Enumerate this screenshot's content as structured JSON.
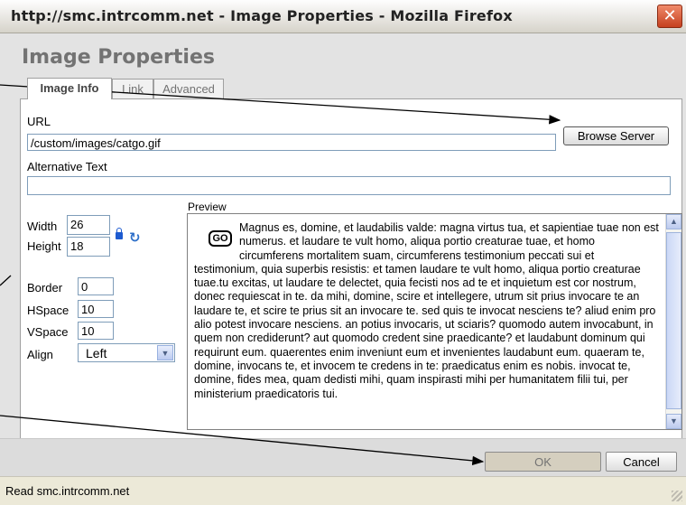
{
  "window": {
    "title": "http://smc.intrcomm.net - Image Properties - Mozilla Firefox",
    "close_glyph": "✕"
  },
  "dialog": {
    "heading": "Image Properties",
    "tabs": [
      {
        "label": "Image Info",
        "active": true
      },
      {
        "label": "Link",
        "active": false
      },
      {
        "label": "Advanced",
        "active": false
      }
    ],
    "url_label": "URL",
    "url_value": "/custom/images/catgo.gif",
    "browse_label": "Browse Server",
    "alt_label": "Alternative Text",
    "alt_value": "",
    "width_label": "Width",
    "width_value": "26",
    "height_label": "Height",
    "height_value": "18",
    "border_label": "Border",
    "border_value": "0",
    "hspace_label": "HSpace",
    "hspace_value": "10",
    "vspace_label": "VSpace",
    "vspace_value": "10",
    "align_label": "Align",
    "align_value": "Left",
    "preview_label": "Preview",
    "preview_image_text": "GO",
    "preview_text": "Magnus es, domine, et laudabilis valde: magna virtus tua, et sapientiae tuae non est numerus. et laudare te vult homo, aliqua portio creaturae tuae, et homo circumferens mortalitem suam, circumferens testimonium peccati sui et testimonium, quia superbis resistis: et tamen laudare te vult homo, aliqua portio creaturae tuae.tu excitas, ut laudare te delectet, quia fecisti nos ad te et inquietum est cor nostrum, donec requiescat in te. da mihi, domine, scire et intellegere, utrum sit prius invocare te an laudare te, et scire te prius sit an invocare te. sed quis te invocat nesciens te? aliud enim pro alio potest invocare nesciens. an potius invocaris, ut sciaris? quomodo autem invocabunt, in quem non crediderunt? aut quomodo credent sine praedicante? et laudabunt dominum qui requirunt eum. quaerentes enim inveniunt eum et invenientes laudabunt eum. quaeram te, domine, invocans te, et invocem te credens in te: praedicatus enim es nobis. invocat te, domine, fides mea, quam dedisti mihi, quam inspirasti mihi per humanitatem filii tui, per ministerium praedicatoris tui.",
    "ok_label": "OK",
    "cancel_label": "Cancel"
  },
  "statusbar": {
    "text": "Read smc.intrcomm.net"
  },
  "icons": {
    "lock": "lock-icon",
    "reset": "reset-size-icon",
    "scroll_up": "▲",
    "scroll_down": "▼",
    "dropdown": "▼"
  },
  "colors": {
    "close_button": "#d9532b",
    "annotation_arrow": "#000000"
  }
}
